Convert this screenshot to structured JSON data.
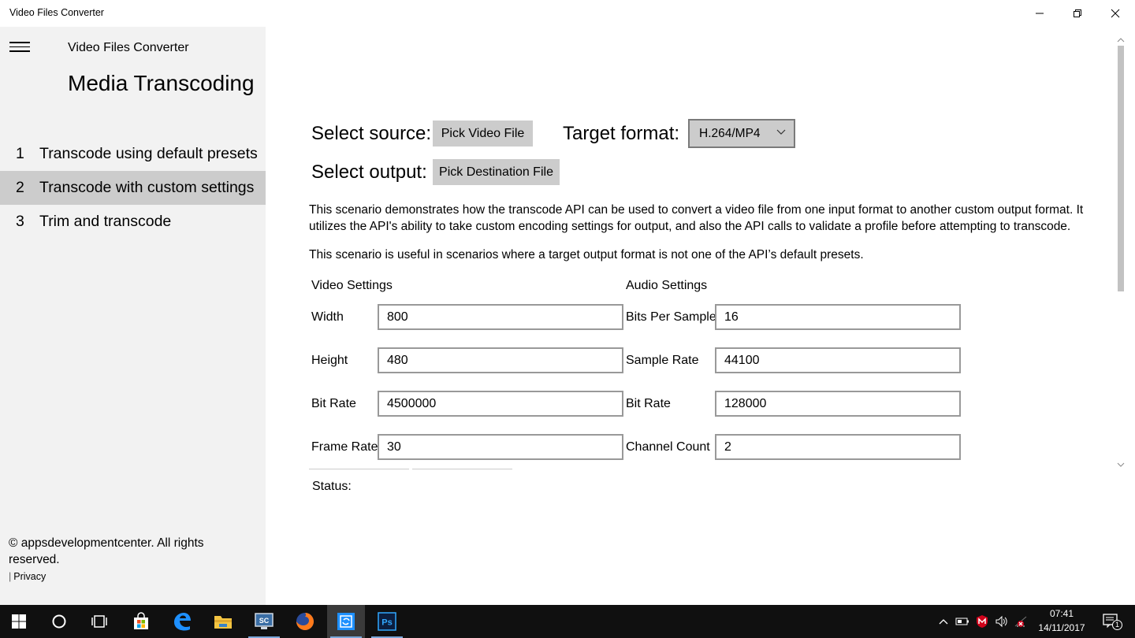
{
  "window": {
    "title": "Video Files Converter"
  },
  "sidebar": {
    "app_name": "Video Files Converter",
    "heading": "Media Transcoding",
    "items": [
      {
        "number": "1",
        "label": "Transcode using default presets",
        "selected": false
      },
      {
        "number": "2",
        "label": "Transcode with custom settings",
        "selected": true
      },
      {
        "number": "3",
        "label": "Trim and transcode",
        "selected": false
      }
    ],
    "copyright": "© appsdevelopmentcenter. All rights reserved.",
    "privacy_separator": "|",
    "privacy_label": "Privacy"
  },
  "main": {
    "select_source_label": "Select source:",
    "pick_video_button": "Pick Video File",
    "target_format_label": "Target format:",
    "target_format_value": "H.264/MP4",
    "select_output_label": "Select output:",
    "pick_destination_button": "Pick Destination File",
    "description": "This scenario demonstrates how the transcode API can be used to convert a video file from one input format to another custom output format. It utilizes the API's ability to take custom encoding settings for output, and also the API calls to validate a profile before attempting to transcode.",
    "description2": "This scenario is useful in scenarios where a target output format is not one of the API’s default presets.",
    "video_settings": {
      "title": "Video Settings",
      "width_label": "Width",
      "width_value": "800",
      "height_label": "Height",
      "height_value": "480",
      "bitrate_label": "Bit Rate",
      "bitrate_value": "4500000",
      "framerate_label": "Frame Rate",
      "framerate_value": "30"
    },
    "audio_settings": {
      "title": "Audio Settings",
      "bits_label": "Bits Per Sample",
      "bits_value": "16",
      "samplerate_label": "Sample Rate",
      "samplerate_value": "44100",
      "bitrate_label": "Bit Rate",
      "bitrate_value": "128000",
      "channels_label": "Channel Count",
      "channels_value": "2"
    },
    "status_label": "Status:"
  },
  "taskbar": {
    "time": "07:41",
    "date": "14/11/2017",
    "notification_count": "1",
    "colors": {
      "background": "#101010",
      "edge": "#1e90ff",
      "store": "#ffffff",
      "explorer": "#f4c542",
      "firefox": "#ff7a1a",
      "photoshop": "#0b1e3f",
      "antivirus": "#d0021b"
    }
  }
}
